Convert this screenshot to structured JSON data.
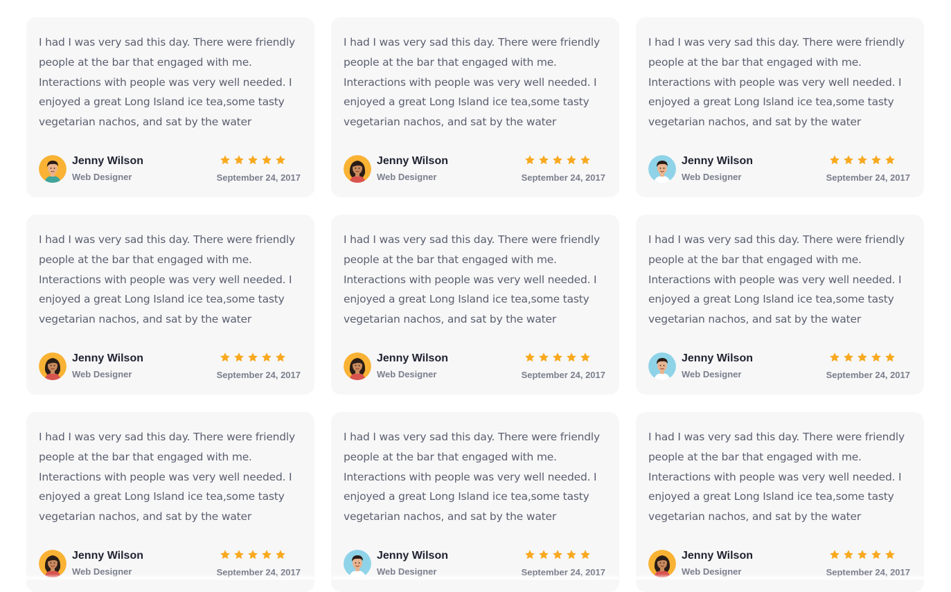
{
  "colors": {
    "card_background": "#f7f7f8",
    "star": "#f8a91f",
    "body_text": "#5b5f6e",
    "name_text": "#1f2230",
    "muted_text": "#7b7f8c"
  },
  "rating_max": 5,
  "reviews": [
    {
      "text": "I had I was very sad this day. There were friendly people at the bar that engaged with me. Interactions with people was very well needed. I enjoyed a great Long Island ice tea,some tasty vegetarian nachos, and sat by the water",
      "name": "Jenny Wilson",
      "role": "Web Designer",
      "date": "September 24, 2017",
      "rating": 5,
      "avatar": "avatar-man-orange"
    },
    {
      "text": "I had I was very sad this day. There were friendly people at the bar that engaged with me. Interactions with people was very well needed. I enjoyed a great Long Island ice tea,some tasty vegetarian nachos, and sat by the water",
      "name": "Jenny Wilson",
      "role": "Web Designer",
      "date": "September 24, 2017",
      "rating": 5,
      "avatar": "avatar-woman-orange"
    },
    {
      "text": "I had I was very sad this day. There were friendly people at the bar that engaged with me. Interactions with people was very well needed. I enjoyed a great Long Island ice tea,some tasty vegetarian nachos, and sat by the water",
      "name": "Jenny Wilson",
      "role": "Web Designer",
      "date": "September 24, 2017",
      "rating": 5,
      "avatar": "avatar-man-blue"
    },
    {
      "text": "I had I was very sad this day. There were friendly people at the bar that engaged with me. Interactions with people was very well needed. I enjoyed a great Long Island ice tea,some tasty vegetarian nachos, and sat by the water",
      "name": "Jenny Wilson",
      "role": "Web Designer",
      "date": "September 24, 2017",
      "rating": 5,
      "avatar": "avatar-woman-orange"
    },
    {
      "text": "I had I was very sad this day. There were friendly people at the bar that engaged with me. Interactions with people was very well needed. I enjoyed a great Long Island ice tea,some tasty vegetarian nachos, and sat by the water",
      "name": "Jenny Wilson",
      "role": "Web Designer",
      "date": "September 24, 2017",
      "rating": 5,
      "avatar": "avatar-woman-orange"
    },
    {
      "text": "I had I was very sad this day. There were friendly people at the bar that engaged with me. Interactions with people was very well needed. I enjoyed a great Long Island ice tea,some tasty vegetarian nachos, and sat by the water",
      "name": "Jenny Wilson",
      "role": "Web Designer",
      "date": "September 24, 2017",
      "rating": 5,
      "avatar": "avatar-man-blue"
    },
    {
      "text": "I had I was very sad this day. There were friendly people at the bar that engaged with me. Interactions with people was very well needed. I enjoyed a great Long Island ice tea,some tasty vegetarian nachos, and sat by the water",
      "name": "Jenny Wilson",
      "role": "Web Designer",
      "date": "September 24, 2017",
      "rating": 5,
      "avatar": "avatar-woman-orange"
    },
    {
      "text": "I had I was very sad this day. There were friendly people at the bar that engaged with me. Interactions with people was very well needed. I enjoyed a great Long Island ice tea,some tasty vegetarian nachos, and sat by the water",
      "name": "Jenny Wilson",
      "role": "Web Designer",
      "date": "September 24, 2017",
      "rating": 5,
      "avatar": "avatar-man-blue"
    },
    {
      "text": "I had I was very sad this day. There were friendly people at the bar that engaged with me. Interactions with people was very well needed. I enjoyed a great Long Island ice tea,some tasty vegetarian nachos, and sat by the water",
      "name": "Jenny Wilson",
      "role": "Web Designer",
      "date": "September 24, 2017",
      "rating": 5,
      "avatar": "avatar-woman-orange"
    }
  ]
}
